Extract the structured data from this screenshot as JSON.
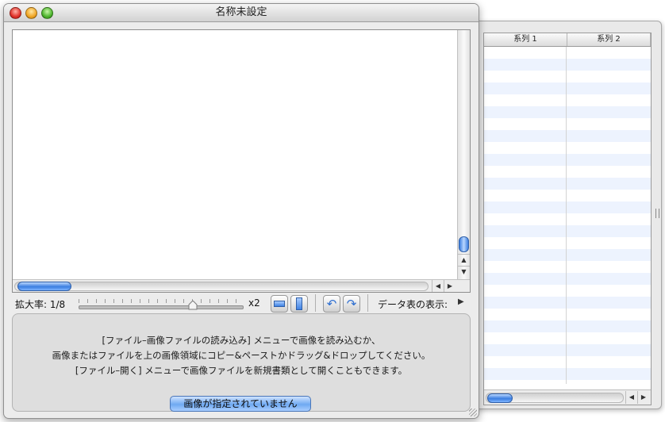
{
  "window": {
    "title": "名称未設定"
  },
  "drawer": {
    "columns": [
      "系列 1",
      "系列 2"
    ]
  },
  "toolbar": {
    "zoom_label": "拡大率: 1/8",
    "zoom_max_label": "x2",
    "zoom_level": 0.72,
    "data_table_label": "データ表の表示:"
  },
  "message": {
    "line1": "[ファイル–画像ファイルの読み込み] メニューで画像を読み込むか、",
    "line2": "画像またはファイルを上の画像領域にコピー&ペーストかドラッグ&ドロップしてください。",
    "line3": "[ファイル–開く] メニューで画像ファイルを新規書類として開くこともできます。"
  },
  "status": {
    "button_label": "画像が指定されていません"
  },
  "colors": {
    "accent": "#3b7ee0",
    "row_stripe": "#edf3fe"
  }
}
